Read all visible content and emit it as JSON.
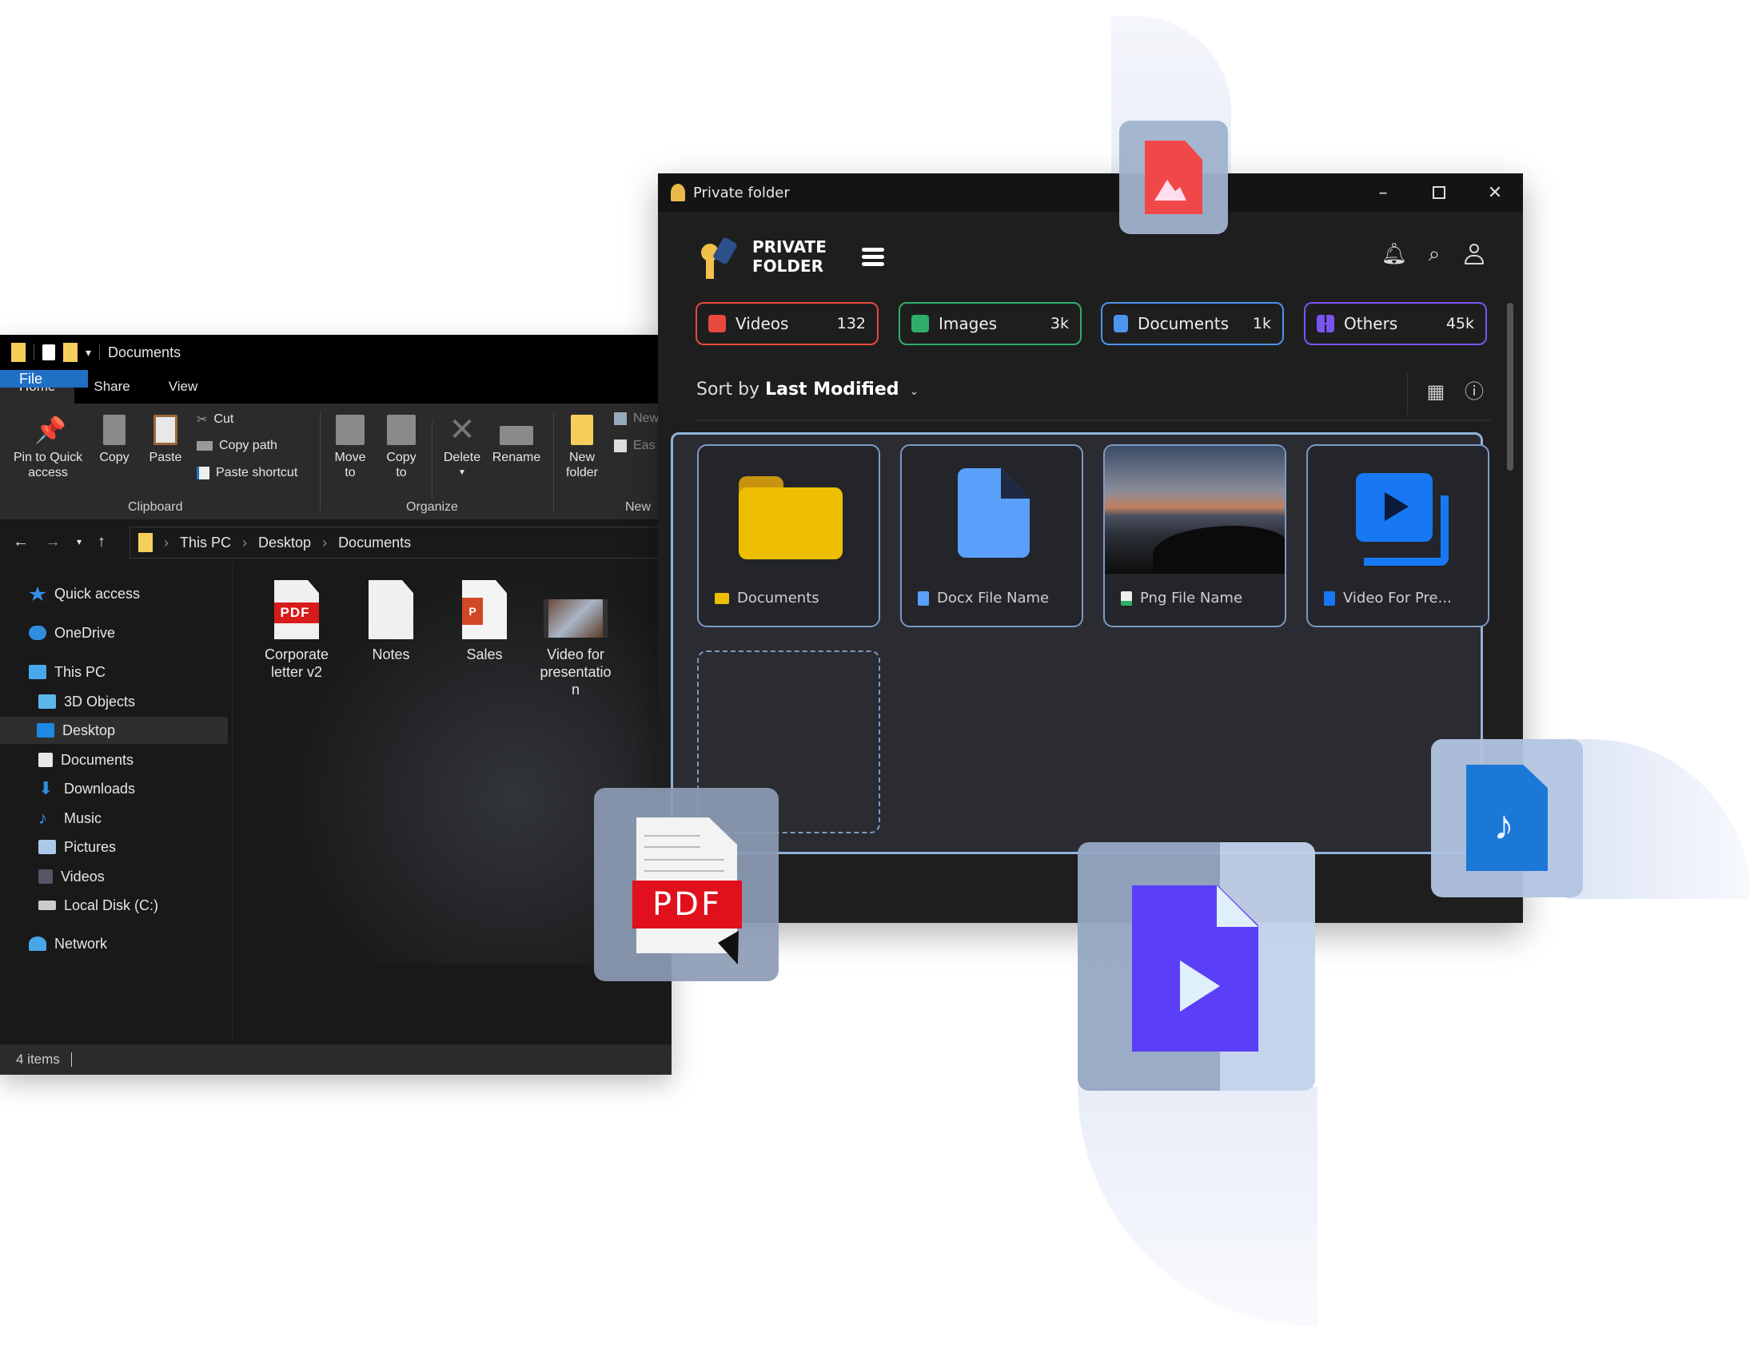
{
  "explorer": {
    "title": "Documents",
    "tabs": [
      "File",
      "Home",
      "Share",
      "View"
    ],
    "ribbon": {
      "pin": "Pin to Quick access",
      "pin_l1": "Pin to Quick",
      "pin_l2": "access",
      "copy": "Copy",
      "paste": "Paste",
      "cut": "Cut",
      "copy_path": "Copy path",
      "paste_shortcut": "Paste shortcut",
      "move_l1": "Move",
      "move_l2": "to",
      "copyto_l1": "Copy",
      "copyto_l2": "to",
      "delete": "Delete",
      "rename": "Rename",
      "newfolder_l1": "New",
      "newfolder_l2": "folder",
      "new_item": "New",
      "easy_access": "Eas",
      "groups": {
        "clipboard": "Clipboard",
        "organize": "Organize",
        "new": "New"
      }
    },
    "breadcrumb": [
      "This PC",
      "Desktop",
      "Documents"
    ],
    "sidebar": [
      {
        "label": "Quick access",
        "icon": "star-icon"
      },
      {
        "label": "OneDrive",
        "icon": "cloud-icon"
      },
      {
        "label": "This PC",
        "icon": "computer-icon"
      },
      {
        "label": "3D Objects",
        "icon": "cube-icon"
      },
      {
        "label": "Desktop",
        "icon": "desktop-icon",
        "selected": true
      },
      {
        "label": "Documents",
        "icon": "document-icon"
      },
      {
        "label": "Downloads",
        "icon": "download-icon"
      },
      {
        "label": "Music",
        "icon": "music-icon"
      },
      {
        "label": "Pictures",
        "icon": "picture-icon"
      },
      {
        "label": "Videos",
        "icon": "video-icon"
      },
      {
        "label": "Local Disk (C:)",
        "icon": "disk-icon"
      },
      {
        "label": "Network",
        "icon": "network-icon"
      }
    ],
    "files": [
      {
        "l1": "Corporate",
        "l2": "letter v2",
        "type": "pdf"
      },
      {
        "l1": "Notes",
        "l2": "",
        "type": "text"
      },
      {
        "l1": "Sales",
        "l2": "",
        "type": "powerpoint"
      },
      {
        "l1": "Video for",
        "l2": "presentatio",
        "l3": "n",
        "type": "video"
      }
    ],
    "status": "4 items"
  },
  "private_folder": {
    "window_title": "Private folder",
    "brand_l1": "PRIVATE",
    "brand_l2": "FOLDER",
    "categories": [
      {
        "label": "Videos",
        "count": "132",
        "color": "#e8493f"
      },
      {
        "label": "Images",
        "count": "3k",
        "color": "#2fae6a"
      },
      {
        "label": "Documents",
        "count": "1k",
        "color": "#4c94ee"
      },
      {
        "label": "Others",
        "count": "45k",
        "color": "#7a55f0"
      }
    ],
    "sort_prefix": "Sort by",
    "sort_value": "Last Modified",
    "items": [
      {
        "label": "Documents",
        "type": "folder"
      },
      {
        "label": "Docx File Name",
        "type": "docx"
      },
      {
        "label": "Png File Name",
        "type": "png"
      },
      {
        "label": "Video For Pre...",
        "type": "video"
      }
    ]
  },
  "floating": {
    "pdf_badge": "PDF"
  },
  "colors": {
    "accent_blue": "#8fb2dc",
    "folder_yellow": "#eebf00",
    "doc_blue": "#5aa0fb",
    "video_blue": "#1877f2",
    "video_purple": "#5b3ff8",
    "image_red": "#f04848"
  }
}
